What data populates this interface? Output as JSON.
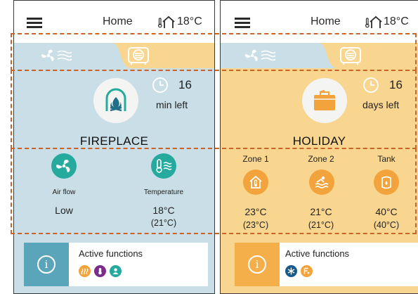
{
  "left_screen": {
    "header": {
      "title": "Home",
      "temperature": "18°C"
    },
    "tabs": [
      {
        "name": "ventilation",
        "icon": "fan-icon",
        "active": true
      },
      {
        "name": "fireplace",
        "icon": "fireplace-tab-icon",
        "active": false
      }
    ],
    "mode": {
      "name": "FIREPLACE",
      "icon": "fireplace-icon",
      "countdown_value": "16",
      "countdown_unit": "min left"
    },
    "details": [
      {
        "icon": "fan-icon",
        "label": "Air flow",
        "value": "Low",
        "sub_value": ""
      },
      {
        "icon": "thermometer-icon",
        "label": "Temperature",
        "value": "18°C",
        "sub_value": "(21°C)"
      }
    ],
    "active_functions": {
      "label": "Active functions",
      "icons": [
        "heating-icon",
        "thermostat-icon",
        "user-icon"
      ],
      "icon_colors": [
        "#f2a33b",
        "#7a2e8a",
        "#27aa9e"
      ]
    }
  },
  "right_screen": {
    "header": {
      "title": "Home",
      "temperature": "18°C"
    },
    "tabs": [
      {
        "name": "ventilation",
        "icon": "fan-icon",
        "active": true
      },
      {
        "name": "holiday",
        "icon": "holiday-tab-icon",
        "active": false
      }
    ],
    "mode": {
      "name": "HOLIDAY",
      "icon": "suitcase-icon",
      "countdown_value": "16",
      "countdown_unit": "days left"
    },
    "zones": [
      {
        "name": "Zone 1",
        "icon": "house-thermometer-icon",
        "value": "23°C",
        "sub_value": "(23°C)"
      },
      {
        "name": "Zone 2",
        "icon": "pool-icon",
        "value": "21°C",
        "sub_value": "(21°C)"
      },
      {
        "name": "Tank",
        "icon": "water-tank-icon",
        "value": "40°C",
        "sub_value": "(40°C)"
      }
    ],
    "active_functions": {
      "label": "Active functions",
      "icons": [
        "snowflake-icon",
        "boost-icon"
      ],
      "icon_colors": [
        "#155a8a",
        "#f2a33b"
      ]
    }
  },
  "colors": {
    "teal_bg": "#c9dee6",
    "yellow_bg": "#f9d68f",
    "teal_accent": "#27aa9e",
    "orange_accent": "#f2a33b",
    "info_teal": "#5ba5bb",
    "info_orange": "#f4ae4a",
    "highlight_dashes": "#c8642a"
  }
}
